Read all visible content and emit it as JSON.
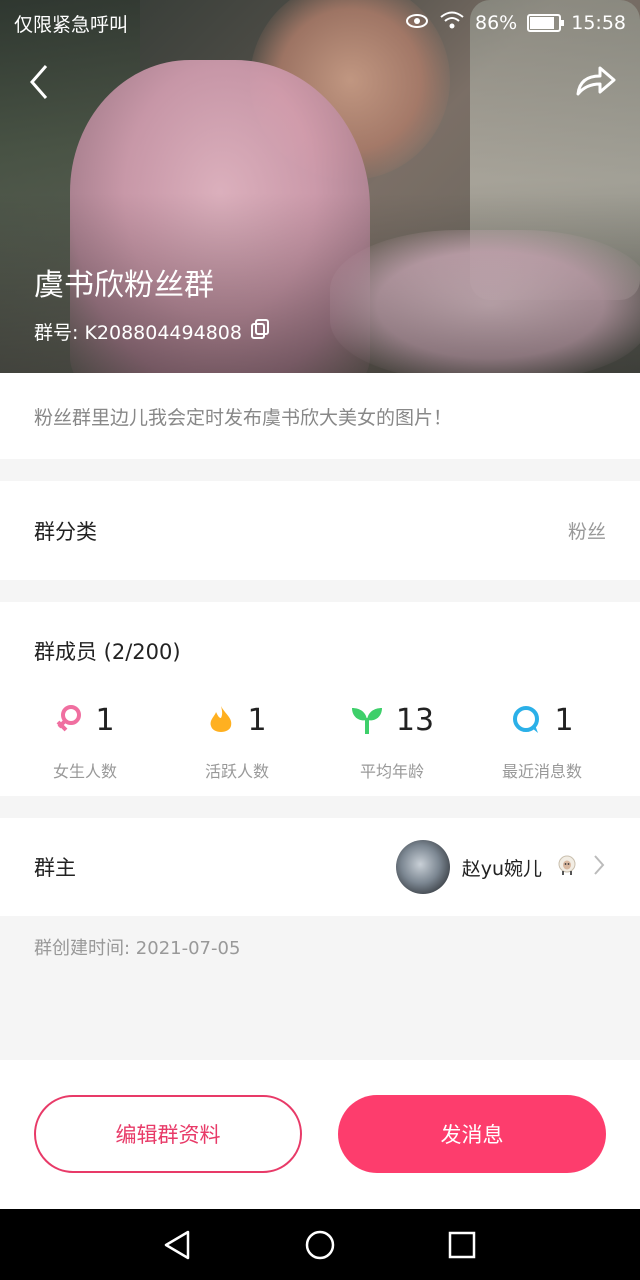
{
  "status_bar": {
    "left_text": "仅限紧急呼叫",
    "battery": "86%",
    "battery_level": 0.86,
    "time": "15:58",
    "icons": [
      "eye-icon",
      "wifi-icon",
      "battery-icon"
    ]
  },
  "header": {
    "group_name": "虞书欣粉丝群",
    "group_id": "群号: K208804494808",
    "icons": [
      "back-icon",
      "share-icon",
      "copy-icon"
    ]
  },
  "description": "粉丝群里边儿我会定时发布虞书欣大美女的图片！",
  "category": {
    "label": "群分类",
    "value": "粉丝"
  },
  "members": {
    "title": "群成员 (2/200)",
    "stats": [
      {
        "icon": "female-icon",
        "value": "1",
        "caption": "女生人数",
        "color": "#f06fa0"
      },
      {
        "icon": "fire-icon",
        "value": "1",
        "caption": "活跃人数",
        "color": "#ffb020"
      },
      {
        "icon": "sprout-icon",
        "value": "13",
        "caption": "平均年龄",
        "color": "#3ecf6a"
      },
      {
        "icon": "chat-bubble-icon",
        "value": "1",
        "caption": "最近消息数",
        "color": "#2bb0e8"
      }
    ]
  },
  "owner": {
    "label": "群主",
    "name": "赵yu婉儿",
    "icons": [
      "sheep-icon",
      "chevron-right-icon"
    ]
  },
  "created": "群创建时间: 2021-07-05",
  "actions": {
    "edit": "编辑群资料",
    "send": "发消息"
  },
  "colors": {
    "accent": "#fd3d6d",
    "edit_border": "#e83a68"
  },
  "nav": [
    "back-triangle-icon",
    "home-circle-icon",
    "recents-square-icon"
  ]
}
